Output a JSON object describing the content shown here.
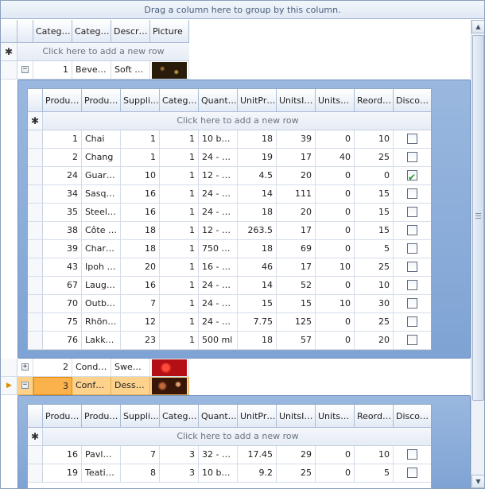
{
  "group_panel_text": "Drag a column here to group by this column.",
  "new_row_text": "Click here to add a new row",
  "master": {
    "columns": [
      "Catego...",
      "Catego...",
      "Descri...",
      "Picture"
    ],
    "rows": [
      {
        "id": "1",
        "name": "Bevera...",
        "desc": "Soft dr...",
        "expander": "−",
        "picture_color": "#3a2a10"
      },
      {
        "id": "2",
        "name": "Condi...",
        "desc": "Sweet...",
        "expander": "+",
        "picture_color": "#c8161a"
      },
      {
        "id": "3",
        "name": "Confe...",
        "desc": "Desser...",
        "expander": "−",
        "picture_color": "#5a2410"
      }
    ]
  },
  "detail": {
    "columns": [
      "Produc...",
      "Produc...",
      "Suppli...",
      "Catego...",
      "Quanti...",
      "UnitPri...",
      "UnitsIn...",
      "UnitsO...",
      "Reorde...",
      "Discon..."
    ],
    "rows_1": [
      {
        "pid": "1",
        "pname": "Chai",
        "sup": "1",
        "cat": "1",
        "qty": "10 box...",
        "price": "18",
        "stock": "39",
        "order": "0",
        "reorder": "10",
        "disc": false
      },
      {
        "pid": "2",
        "pname": "Chang",
        "sup": "1",
        "cat": "1",
        "qty": "24 - 1...",
        "price": "19",
        "stock": "17",
        "order": "40",
        "reorder": "25",
        "disc": false
      },
      {
        "pid": "24",
        "pname": "Guara...",
        "sup": "10",
        "cat": "1",
        "qty": "12 - 3...",
        "price": "4.5",
        "stock": "20",
        "order": "0",
        "reorder": "0",
        "disc": true
      },
      {
        "pid": "34",
        "pname": "Sasqu...",
        "sup": "16",
        "cat": "1",
        "qty": "24 - 1...",
        "price": "14",
        "stock": "111",
        "order": "0",
        "reorder": "15",
        "disc": false
      },
      {
        "pid": "35",
        "pname": "Steele...",
        "sup": "16",
        "cat": "1",
        "qty": "24 - 1...",
        "price": "18",
        "stock": "20",
        "order": "0",
        "reorder": "15",
        "disc": false
      },
      {
        "pid": "38",
        "pname": "Côte d...",
        "sup": "18",
        "cat": "1",
        "qty": "12 - 7...",
        "price": "263.5",
        "stock": "17",
        "order": "0",
        "reorder": "15",
        "disc": false
      },
      {
        "pid": "39",
        "pname": "Chartr...",
        "sup": "18",
        "cat": "1",
        "qty": "750 cc...",
        "price": "18",
        "stock": "69",
        "order": "0",
        "reorder": "5",
        "disc": false
      },
      {
        "pid": "43",
        "pname": "Ipoh C...",
        "sup": "20",
        "cat": "1",
        "qty": "16 - 5...",
        "price": "46",
        "stock": "17",
        "order": "10",
        "reorder": "25",
        "disc": false
      },
      {
        "pid": "67",
        "pname": "Laughi...",
        "sup": "16",
        "cat": "1",
        "qty": "24 - 1...",
        "price": "14",
        "stock": "52",
        "order": "0",
        "reorder": "10",
        "disc": false
      },
      {
        "pid": "70",
        "pname": "Outba...",
        "sup": "7",
        "cat": "1",
        "qty": "24 - 3...",
        "price": "15",
        "stock": "15",
        "order": "10",
        "reorder": "30",
        "disc": false
      },
      {
        "pid": "75",
        "pname": "Rhönb...",
        "sup": "12",
        "cat": "1",
        "qty": "24 - 0...",
        "price": "7.75",
        "stock": "125",
        "order": "0",
        "reorder": "25",
        "disc": false
      },
      {
        "pid": "76",
        "pname": "Lakkali...",
        "sup": "23",
        "cat": "1",
        "qty": "500 ml",
        "price": "18",
        "stock": "57",
        "order": "0",
        "reorder": "20",
        "disc": false
      }
    ],
    "rows_3": [
      {
        "pid": "16",
        "pname": "Pavlova",
        "sup": "7",
        "cat": "3",
        "qty": "32 - 5...",
        "price": "17.45",
        "stock": "29",
        "order": "0",
        "reorder": "10",
        "disc": false
      },
      {
        "pid": "19",
        "pname": "Teatim...",
        "sup": "8",
        "cat": "3",
        "qty": "10 box...",
        "price": "9.2",
        "stock": "25",
        "order": "0",
        "reorder": "5",
        "disc": false
      }
    ]
  }
}
